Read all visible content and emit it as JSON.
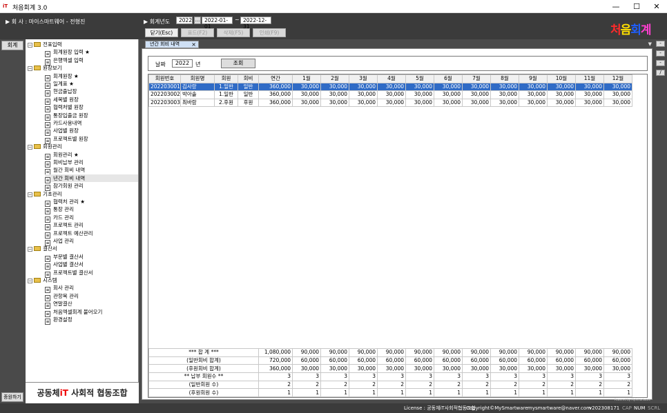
{
  "window": {
    "title": "처음회계 3.0",
    "logo_text": "iT",
    "minimize": "—",
    "maximize": "☐",
    "close": "✕"
  },
  "header": {
    "company_label": "▶ 회 사 : 마이스마트웨어 - 전형진",
    "fiscal_label": "▶ 회계년도",
    "fiscal_year": "2022",
    "date_from": "2022-01-01",
    "date_sep": "~",
    "date_to": "2022-12-31",
    "date_btn": "...",
    "buttons": [
      {
        "label": "닫기(Esc)",
        "active": true
      },
      {
        "label": "표드(F2)",
        "active": false
      },
      {
        "label": "삭제(F5)",
        "active": false
      },
      {
        "label": "인쇄(F9)",
        "active": false
      }
    ],
    "brand": [
      "처",
      "음",
      "회",
      "계"
    ],
    "brand_colors": [
      "#ff2a2a",
      "#ffe000",
      "#1f5fff",
      "#ff3fd0"
    ]
  },
  "left_strip": {
    "top_button": "회계",
    "bottom_button": "종원하기"
  },
  "tree": [
    {
      "type": "group",
      "label": "전표입력"
    },
    {
      "type": "item",
      "label": "회계원장 입력 ★"
    },
    {
      "type": "item",
      "label": "은행엑셀 입력"
    },
    {
      "type": "group",
      "label": "원장보기"
    },
    {
      "type": "item",
      "label": "회계원장 ★"
    },
    {
      "type": "item",
      "label": "일계표 ★"
    },
    {
      "type": "item",
      "label": "현금출납장"
    },
    {
      "type": "item",
      "label": "세목별 원장"
    },
    {
      "type": "item",
      "label": "협력처별 원장"
    },
    {
      "type": "item",
      "label": "통장입출금 원장"
    },
    {
      "type": "item",
      "label": "카드사용내역"
    },
    {
      "type": "item",
      "label": "사업별 원장"
    },
    {
      "type": "item",
      "label": "프로젝트별 원장"
    },
    {
      "type": "group",
      "label": "회원관리"
    },
    {
      "type": "item",
      "label": "회원관리 ★"
    },
    {
      "type": "item",
      "label": "회비납부 관리"
    },
    {
      "type": "item",
      "label": "월간 회비 내역"
    },
    {
      "type": "item",
      "label": "년간 회비 내역",
      "selected": true
    },
    {
      "type": "item",
      "label": "참가회원 관리"
    },
    {
      "type": "group",
      "label": "기초관리"
    },
    {
      "type": "item",
      "label": "협력처 관리 ★"
    },
    {
      "type": "item",
      "label": "통장 관리"
    },
    {
      "type": "item",
      "label": "카드 관리"
    },
    {
      "type": "item",
      "label": "프로젝트 관리"
    },
    {
      "type": "item",
      "label": "프로젝트 예산관리"
    },
    {
      "type": "item",
      "label": "사업 관리"
    },
    {
      "type": "group",
      "label": "결산서"
    },
    {
      "type": "item",
      "label": "부문별 결산서"
    },
    {
      "type": "item",
      "label": "사업별 결산서"
    },
    {
      "type": "item",
      "label": "프로젝트별 결산서"
    },
    {
      "type": "group",
      "label": "시스템"
    },
    {
      "type": "item",
      "label": "회사 관리"
    },
    {
      "type": "item",
      "label": "관항목 관리"
    },
    {
      "type": "item",
      "label": "연말결산"
    },
    {
      "type": "item",
      "label": "처음엑셀회계 불어오기"
    },
    {
      "type": "item",
      "label": "환경설정"
    }
  ],
  "org": {
    "prefix": "공동체",
    "it": "iT",
    "suffix": " 사회적 협동조합"
  },
  "tab": {
    "label": "년간 회비 내역",
    "close": "×",
    "arrow": "▼"
  },
  "filter": {
    "label": "날짜",
    "year": "2022",
    "year_unit": "년",
    "button": "조회"
  },
  "table": {
    "headers": [
      "회원번호",
      "회원명",
      "회원",
      "회비",
      "연간",
      "1월",
      "2월",
      "3월",
      "4월",
      "5월",
      "6월",
      "7월",
      "8월",
      "9월",
      "10월",
      "11월",
      "12월"
    ],
    "rows": [
      {
        "selected": true,
        "cells": [
          "202203001",
          "김사랑",
          "1.일반",
          "일반",
          "360,000",
          "30,000",
          "30,000",
          "30,000",
          "30,000",
          "30,000",
          "30,000",
          "30,000",
          "30,000",
          "30,000",
          "30,000",
          "30,000",
          "30,000"
        ]
      },
      {
        "selected": false,
        "cells": [
          "202203002",
          "박아솔",
          "1.일반",
          "일반",
          "360,000",
          "30,000",
          "30,000",
          "30,000",
          "30,000",
          "30,000",
          "30,000",
          "30,000",
          "30,000",
          "30,000",
          "30,000",
          "30,000",
          "30,000"
        ]
      },
      {
        "selected": false,
        "cells": [
          "202203003",
          "최바람",
          "2.후원",
          "후원",
          "360,000",
          "30,000",
          "30,000",
          "30,000",
          "30,000",
          "30,000",
          "30,000",
          "30,000",
          "30,000",
          "30,000",
          "30,000",
          "30,000",
          "30,000"
        ]
      }
    ],
    "footer": [
      {
        "label": "*** 합 계 ***",
        "cells": [
          "1,080,000",
          "90,000",
          "90,000",
          "90,000",
          "90,000",
          "90,000",
          "90,000",
          "90,000",
          "90,000",
          "90,000",
          "90,000",
          "90,000",
          "90,000"
        ]
      },
      {
        "label": "(일반회비 합계)",
        "cells": [
          "720,000",
          "60,000",
          "60,000",
          "60,000",
          "60,000",
          "60,000",
          "60,000",
          "60,000",
          "60,000",
          "60,000",
          "60,000",
          "60,000",
          "60,000"
        ]
      },
      {
        "label": "(후원회비 합계)",
        "cells": [
          "360,000",
          "30,000",
          "30,000",
          "30,000",
          "30,000",
          "30,000",
          "30,000",
          "30,000",
          "30,000",
          "30,000",
          "30,000",
          "30,000",
          "30,000"
        ]
      },
      {
        "label": "** 납부 회원수 **",
        "cells": [
          "3",
          "3",
          "3",
          "3",
          "3",
          "3",
          "3",
          "3",
          "3",
          "3",
          "3",
          "3",
          "3"
        ]
      },
      {
        "label": "(일반회원 수)",
        "cells": [
          "2",
          "2",
          "2",
          "2",
          "2",
          "2",
          "2",
          "2",
          "2",
          "2",
          "2",
          "2",
          "2"
        ]
      },
      {
        "label": "(후원회원 수)",
        "cells": [
          "1",
          "1",
          "1",
          "1",
          "1",
          "1",
          "1",
          "1",
          "1",
          "1",
          "1",
          "1",
          "1"
        ]
      }
    ]
  },
  "powered_by": "Powered by MySmartware",
  "right_buttons": [
    "-",
    "-",
    "-",
    "/"
  ],
  "status": {
    "license": "License : 공동체iT사회적협동조합",
    "copyright": "Copyright©MySmartware",
    "email": "mysmartware@naver.com",
    "version": "v202308171",
    "cap": "CAP",
    "num": "NUM",
    "scrl": "SCRL"
  }
}
